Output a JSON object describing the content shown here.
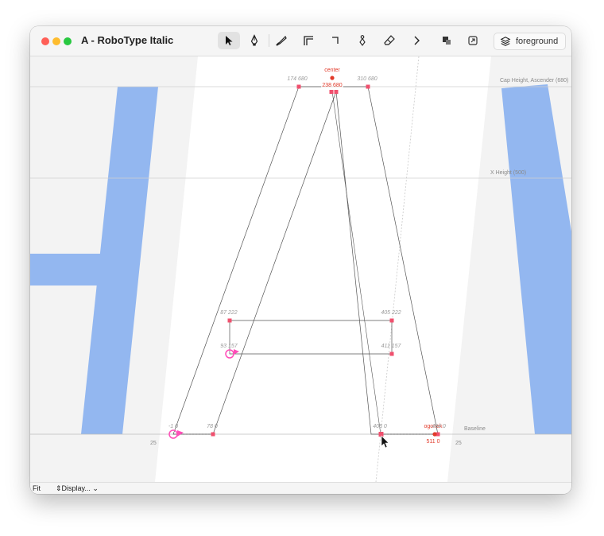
{
  "window": {
    "title": "A - RoboType Italic"
  },
  "toolbar": {
    "tools": [
      "pointer-tool-icon",
      "pen-tool-icon",
      "knife-tool-icon",
      "rectangle-tool-icon",
      "corner-tool-icon",
      "shape-tool-icon",
      "eraser-tool-icon",
      "more-chevron-icon",
      "components-icon",
      "export-icon"
    ],
    "layer_label": "foreground"
  },
  "guides": {
    "cap_height": "Cap Height, Ascender (680)",
    "x_height": "X Height (500)",
    "baseline": "Baseline"
  },
  "anchors": {
    "center": "center",
    "center_coord": "238 680",
    "ogonek": "ogonek",
    "ogonek_coord": "511 0"
  },
  "point_labels": [
    "174 680",
    "310 680",
    "87 222",
    "405 222",
    "93 157",
    "411 157",
    "-1 0",
    "78 0",
    "408 0",
    "494 0"
  ],
  "sidebearings": {
    "left": "25",
    "right": "25"
  },
  "colors": {
    "neighbor_glyph": "#93b7f0",
    "glyph_bg": "#ffffff",
    "point": "#f0506e",
    "anchor": "#e23a2a",
    "start_point": "#ff4db8",
    "outline": "#555555"
  },
  "status": {
    "zoom": "Fit",
    "display": "Display..."
  }
}
